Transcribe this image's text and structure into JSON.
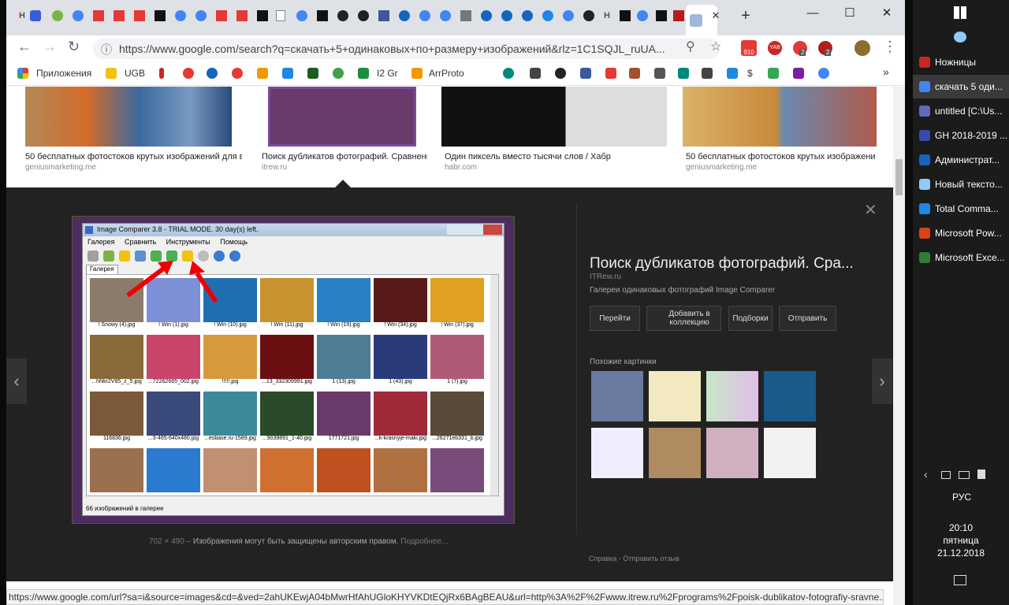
{
  "browser": {
    "tab_letters": [
      "Н",
      "Н"
    ],
    "new_tab": "+",
    "url": "https://www.google.com/search?q=скачать+5+одинаковых+по+размеру+изображений&rlz=1C1SQJL_ruUA...",
    "ext_badges": [
      "910",
      "YAB",
      "2",
      "2"
    ],
    "bookmarks": [
      {
        "label": "Приложения",
        "color": "#e53935"
      },
      {
        "label": "UGB",
        "color": "#f4c20d"
      },
      {
        "label": "I2 Gr",
        "color": "#1e8e3e"
      },
      {
        "label": "ArrProto",
        "color": "#f29900"
      },
      {
        "label": "$",
        "color": "#555"
      }
    ],
    "more": "»"
  },
  "results": [
    {
      "caption": "50 бесплатных фотостоков крутых изображений для ваш...",
      "source": "geniusmarketing.me"
    },
    {
      "caption": "Поиск дубликатов фотографий. Сравнени...",
      "source": "itrew.ru"
    },
    {
      "caption": "Один пиксель вместо тысячи слов / Хабр",
      "source": "habr.com"
    },
    {
      "caption": "50 бесплатных фотостоков крутых изображений ...",
      "source": "geniusmarketing.me"
    }
  ],
  "preview": {
    "close": "✕",
    "prev": "‹",
    "next": "›",
    "title": "Поиск дубликатов фотографий. Сра...",
    "domain": "ITRew.ru",
    "description": "Галереи одинаковых фотографий Image Comparer",
    "buttons": [
      {
        "label": "Перейти"
      },
      {
        "label": "Добавить в коллекцию"
      },
      {
        "label": "Подборки"
      },
      {
        "label": "Отправить"
      }
    ],
    "related_title": "Похожие картинки",
    "meta_size": "702 × 490",
    "meta_note": "Изображения могут быть защищены авторским правом.",
    "meta_more": "Подробнее...",
    "footer_help": "Справка",
    "footer_sep": "-",
    "footer_feedback": "Отправить отзыв",
    "app": {
      "title": "Image Comparer 3.8 - TRIAL MODE. 30 day(s) left.",
      "menu": [
        "Галерея",
        "Сравнить",
        "Инструменты",
        "Помощь"
      ],
      "tab": "Галерея",
      "status": "66 изображений в галерее",
      "cells": [
        {
          "label": "! Snowy (4).jpg",
          "color": "#8b7b6b"
        },
        {
          "label": "! Win (1).jpg",
          "color": "#7d8fd6"
        },
        {
          "label": "! Win (10).jpg",
          "color": "#1f6fb0"
        },
        {
          "label": "! Win (11).jpg",
          "color": "#c8932e"
        },
        {
          "label": "! Win (19).jpg",
          "color": "#2a7fc5"
        },
        {
          "label": "! Win (34).jpg",
          "color": "#5b1a1a"
        },
        {
          "label": "! Win (37).jpg",
          "color": "#e0a020"
        },
        {
          "label": "...hNkr2V85_z_5.jpg",
          "color": "#8a6a3a"
        },
        {
          "label": "...72262665_002.jpg",
          "color": "#c9466a"
        },
        {
          "label": "!!!!!.jpg",
          "color": "#d79a3a"
        },
        {
          "label": "...13_332309991.jpg",
          "color": "#6a1010"
        },
        {
          "label": "1 (13).jpg",
          "color": "#4e7d96"
        },
        {
          "label": "1 (43).jpg",
          "color": "#2a3a7a"
        },
        {
          "label": "1 (7).jpg",
          "color": "#b05a7a"
        },
        {
          "label": "116836.jpg",
          "color": "#7a5a3a"
        },
        {
          "label": "...3-465-640x480.jpg",
          "color": "#3a4a7a"
        },
        {
          "label": "...esbase.ru-1589.jpg",
          "color": "#3a8a9a"
        },
        {
          "label": "...9039891_1-40.jpg",
          "color": "#2a4a2a"
        },
        {
          "label": "1771721.jpg",
          "color": "#6a3a6a"
        },
        {
          "label": "...k-krasnyje-maki.jpg",
          "color": "#a02a3a"
        },
        {
          "label": "...26271eb331_b.jpg",
          "color": "#5a4a3a"
        },
        {
          "label": "",
          "color": "#9a7050"
        },
        {
          "label": "",
          "color": "#2a7ad0"
        },
        {
          "label": "",
          "color": "#c09070"
        },
        {
          "label": "",
          "color": "#d07030"
        },
        {
          "label": "",
          "color": "#c05020"
        },
        {
          "label": "",
          "color": "#b07040"
        },
        {
          "label": "",
          "color": "#7a4a7a"
        }
      ]
    }
  },
  "statusbar": "https://www.google.com/url?sa=i&source=images&cd=&ved=2ahUKEwjA04bMwrHfAhUGloKHYVKDtEQjRx6BAgBEAU&url=http%3A%2F%2Fwww.itrew.ru%2Fprograms%2Fpoisk-dublikatov-fotografiy-sravne...",
  "taskbar": {
    "items": [
      {
        "label": "Ножницы",
        "color": "#c62828"
      },
      {
        "label": "скачать 5 оди...",
        "color": "#4285f4"
      },
      {
        "label": "untitled [C:\\Us...",
        "color": "#5c6bc0"
      },
      {
        "label": "GH 2018-2019 ...",
        "color": "#3949ab"
      },
      {
        "label": "Администрат...",
        "color": "#1565c0"
      },
      {
        "label": "Новый тексто...",
        "color": "#90caf9"
      },
      {
        "label": "Total Comma...",
        "color": "#1e88e5"
      },
      {
        "label": "Microsoft Pow...",
        "color": "#d84315"
      },
      {
        "label": "Microsoft Exce...",
        "color": "#2e7d32"
      }
    ],
    "lang": "РУС",
    "time": "20:10",
    "day": "пятница",
    "date": "21.12.2018"
  }
}
